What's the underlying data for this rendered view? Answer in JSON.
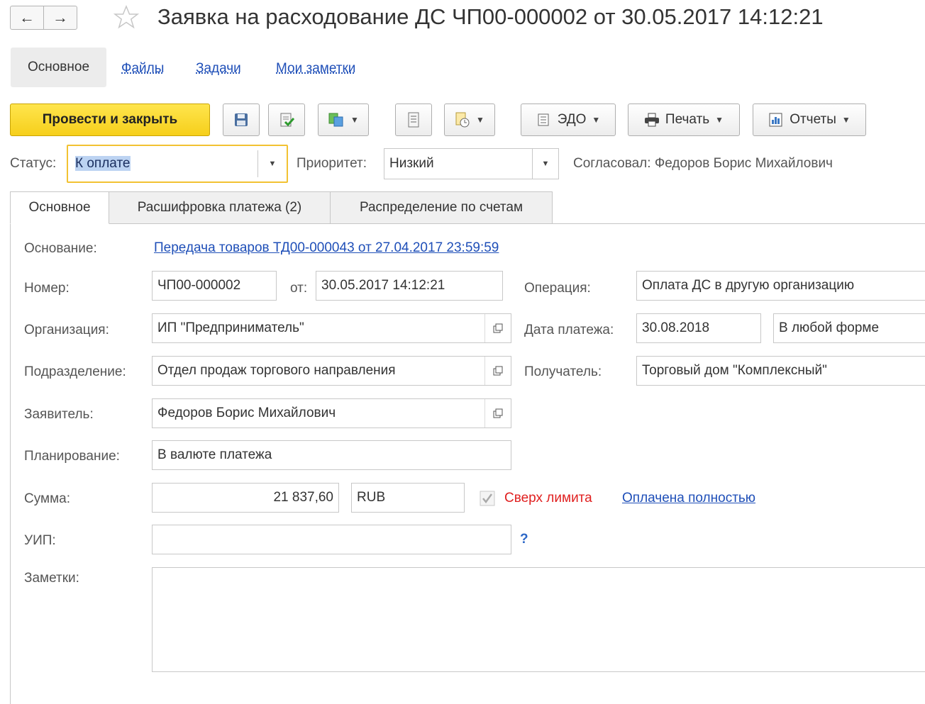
{
  "header": {
    "title": "Заявка на расходование ДС ЧП00-000002 от 30.05.2017 14:12:21",
    "back_icon": "←",
    "forward_icon": "→"
  },
  "sections": {
    "active": "Основное",
    "links": [
      "Файлы",
      "Задачи",
      "Мои заметки"
    ]
  },
  "toolbar": {
    "post_close": "Провести и закрыть",
    "edo": "ЭДО",
    "print": "Печать",
    "reports": "Отчеты"
  },
  "statusbar": {
    "status_label": "Статус:",
    "status_value": "К оплате",
    "priority_label": "Приоритет:",
    "priority_value": "Низкий",
    "approved": "Согласовал: Федоров Борис Михайлович"
  },
  "tabs": [
    "Основное",
    "Расшифровка платежа (2)",
    "Распределение по счетам"
  ],
  "form": {
    "basis_label": "Основание:",
    "basis_link": "Передача товаров ТД00-000043 от 27.04.2017 23:59:59",
    "number_label": "Номер:",
    "number_value": "ЧП00-000002",
    "from_label": "от:",
    "from_value": "30.05.2017 14:12:21",
    "operation_label": "Операция:",
    "operation_value": "Оплата ДС в другую организацию",
    "org_label": "Организация:",
    "org_value": "ИП \"Предприниматель\"",
    "pay_date_label": "Дата платежа:",
    "pay_date_value": "30.08.2018",
    "pay_form_value": "В любой форме",
    "dept_label": "Подразделение:",
    "dept_value": "Отдел продаж торгового направления",
    "recipient_label": "Получатель:",
    "recipient_value": "Торговый дом \"Комплексный\"",
    "applicant_label": "Заявитель:",
    "applicant_value": "Федоров Борис Михайлович",
    "planning_label": "Планирование:",
    "planning_value": "В валюте платежа",
    "sum_label": "Сумма:",
    "sum_value": "21 837,60",
    "currency_value": "RUB",
    "over_limit": "Сверх лимита",
    "paid_link": "Оплачена полностью",
    "uip_label": "УИП:",
    "uip_value": "",
    "uip_help": "?",
    "notes_label": "Заметки:",
    "notes_value": ""
  },
  "colors": {
    "primary_button": "#f6cf1b",
    "link": "#1f4fb8",
    "warning_text": "#e02020",
    "focus_border": "#f2c232"
  }
}
